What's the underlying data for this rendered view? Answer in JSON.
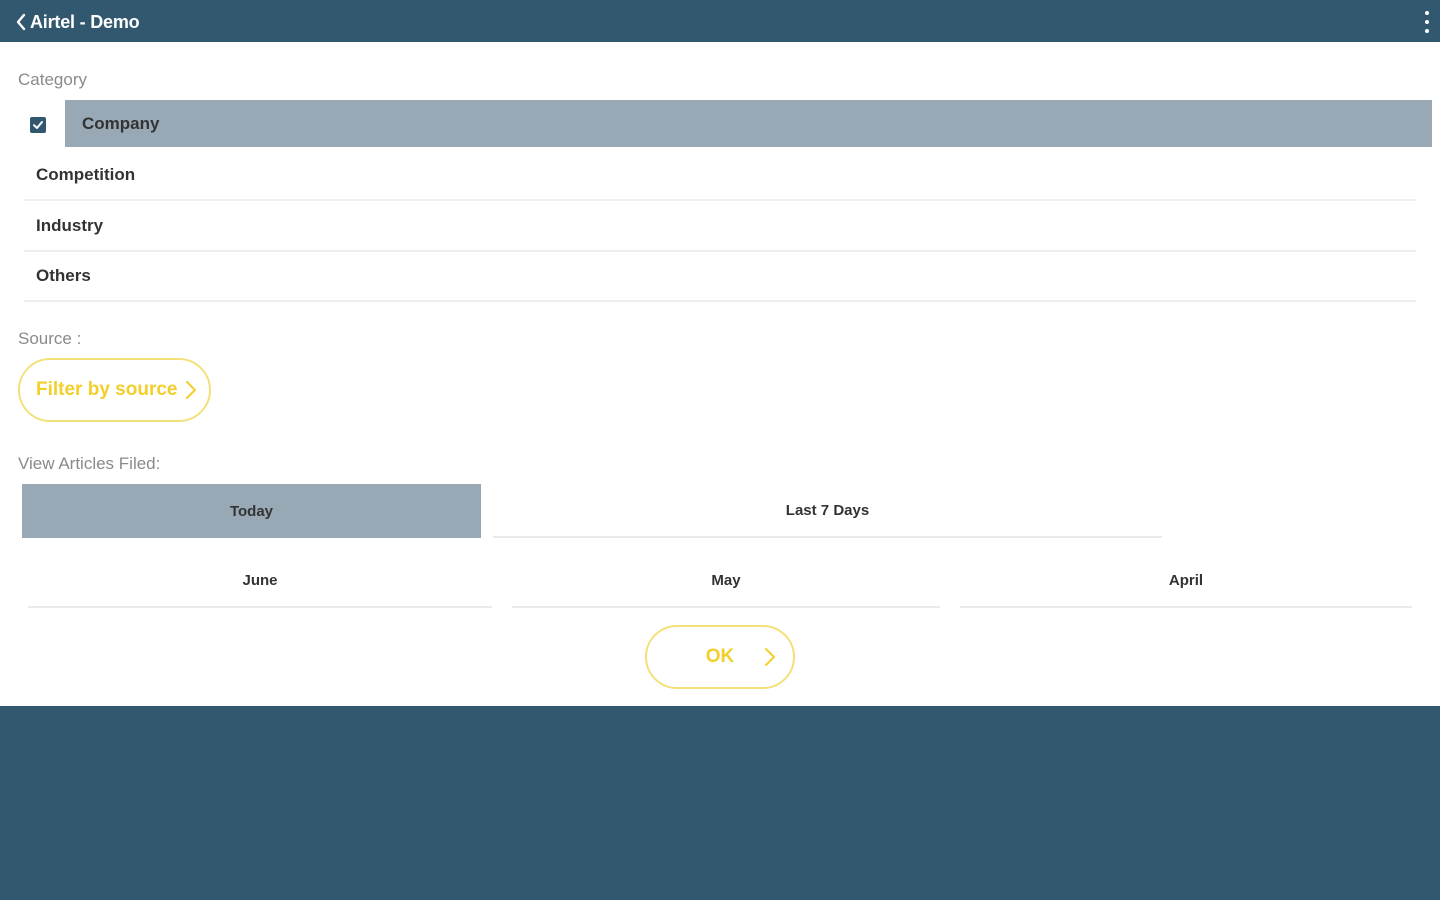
{
  "header": {
    "title": "Airtel - Demo",
    "back_icon": "chevron-left-icon",
    "menu_icon": "more-vertical-icon"
  },
  "category": {
    "label": "Category",
    "items": [
      {
        "label": "Company",
        "checked": true
      },
      {
        "label": "Competition",
        "checked": false
      },
      {
        "label": "Industry",
        "checked": false
      },
      {
        "label": "Others",
        "checked": false
      }
    ]
  },
  "source": {
    "label": "Source :",
    "button_label": "Filter by source"
  },
  "view_articles": {
    "label": "View Articles Filed:",
    "options": [
      {
        "label": "Today",
        "selected": true
      },
      {
        "label": "Last 7 Days",
        "selected": false
      },
      {
        "label": "June",
        "selected": false
      },
      {
        "label": "May",
        "selected": false
      },
      {
        "label": "April",
        "selected": false
      }
    ]
  },
  "ok_button": {
    "label": "OK"
  },
  "colors": {
    "primary": "#325870",
    "selected": "#98a9b5",
    "accent": "#f2cf2a",
    "accent_border": "#f3e07a"
  }
}
